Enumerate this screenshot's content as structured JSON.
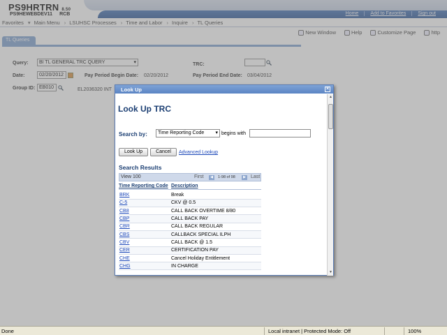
{
  "header": {
    "app_name": "PS9HRTRN",
    "version": "8.50",
    "server": "PS9HEWEBDEV11",
    "user": "RCB",
    "links": [
      "Home",
      "Add to Favorites",
      "Sign out"
    ]
  },
  "menubar": {
    "items": [
      "Favorites",
      "Main Menu",
      "LSUHSC Processes",
      "Time and Labor",
      "Inquire",
      "TL Queries"
    ]
  },
  "pagetools": {
    "new_window": "New Window",
    "help": "Help",
    "customize": "Customize Page",
    "http": "http"
  },
  "page": {
    "tab": "TL Queries",
    "query_label": "Query:",
    "query_value": "BI TL GENERAL TRC QUERY",
    "trc_label": "TRC:",
    "date_label": "Date:",
    "date_value": "02/20/2012",
    "pp_begin_label": "Pay Period Begin Date:",
    "pp_begin_value": "02/20/2012",
    "pp_end_label": "Pay Period End Date:",
    "pp_end_value": "03/04/2012",
    "group_label": "Group ID:",
    "group_value": "EB010",
    "group_desc": "EL2036320 INT"
  },
  "lookup": {
    "window_title": "Look Up",
    "heading": "Look Up TRC",
    "search_by_label": "Search by:",
    "search_by_value": "Time Reporting Code",
    "begins_with": "begins with",
    "lookup_btn": "Look Up",
    "cancel_btn": "Cancel",
    "advanced_link": "Advanced Lookup",
    "results_title": "Search Results",
    "view": "View 100",
    "first": "First",
    "count": "1-98 of 98",
    "last": "Last",
    "col_code": "Time Reporting Code",
    "col_desc": "Description",
    "rows": [
      {
        "code": "BRK",
        "desc": "Break"
      },
      {
        "code": "C-5",
        "desc": "CKV @ 0.5"
      },
      {
        "code": "CB8",
        "desc": "CALL BACK OVERTIME 8/80"
      },
      {
        "code": "CBP",
        "desc": "CALL BACK PAY"
      },
      {
        "code": "CBR",
        "desc": "CALL BACK REGULAR"
      },
      {
        "code": "CBS",
        "desc": "CALLBACK SPECIAL ILPH"
      },
      {
        "code": "CBV",
        "desc": "CALL BACK @ 1.5"
      },
      {
        "code": "CER",
        "desc": "CERTIFICATION PAY"
      },
      {
        "code": "CHE",
        "desc": "Cancel Holiday Entitlement"
      },
      {
        "code": "CHG",
        "desc": "IN CHARGE"
      }
    ]
  },
  "statusbar": {
    "left": "Done",
    "zone": "Local intranet | Protected Mode: Off",
    "zoom": "100%"
  }
}
